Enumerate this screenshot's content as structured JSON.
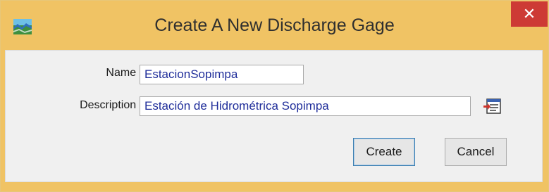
{
  "window": {
    "title": "Create A New Discharge Gage",
    "close_symbol": "✕"
  },
  "form": {
    "name_label": "Name :",
    "name_value": "EstacionSopimpa",
    "description_label": "Description :",
    "description_value": "Estación de Hidrométrica Sopimpa"
  },
  "buttons": {
    "create": "Create",
    "cancel": "Cancel"
  },
  "icons": {
    "app": "gage-map-icon",
    "description_editor": "text-editor-icon"
  },
  "colors": {
    "titlebar": "#f0c364",
    "close_button": "#cd3a35",
    "field_text": "#1f2d9a"
  }
}
